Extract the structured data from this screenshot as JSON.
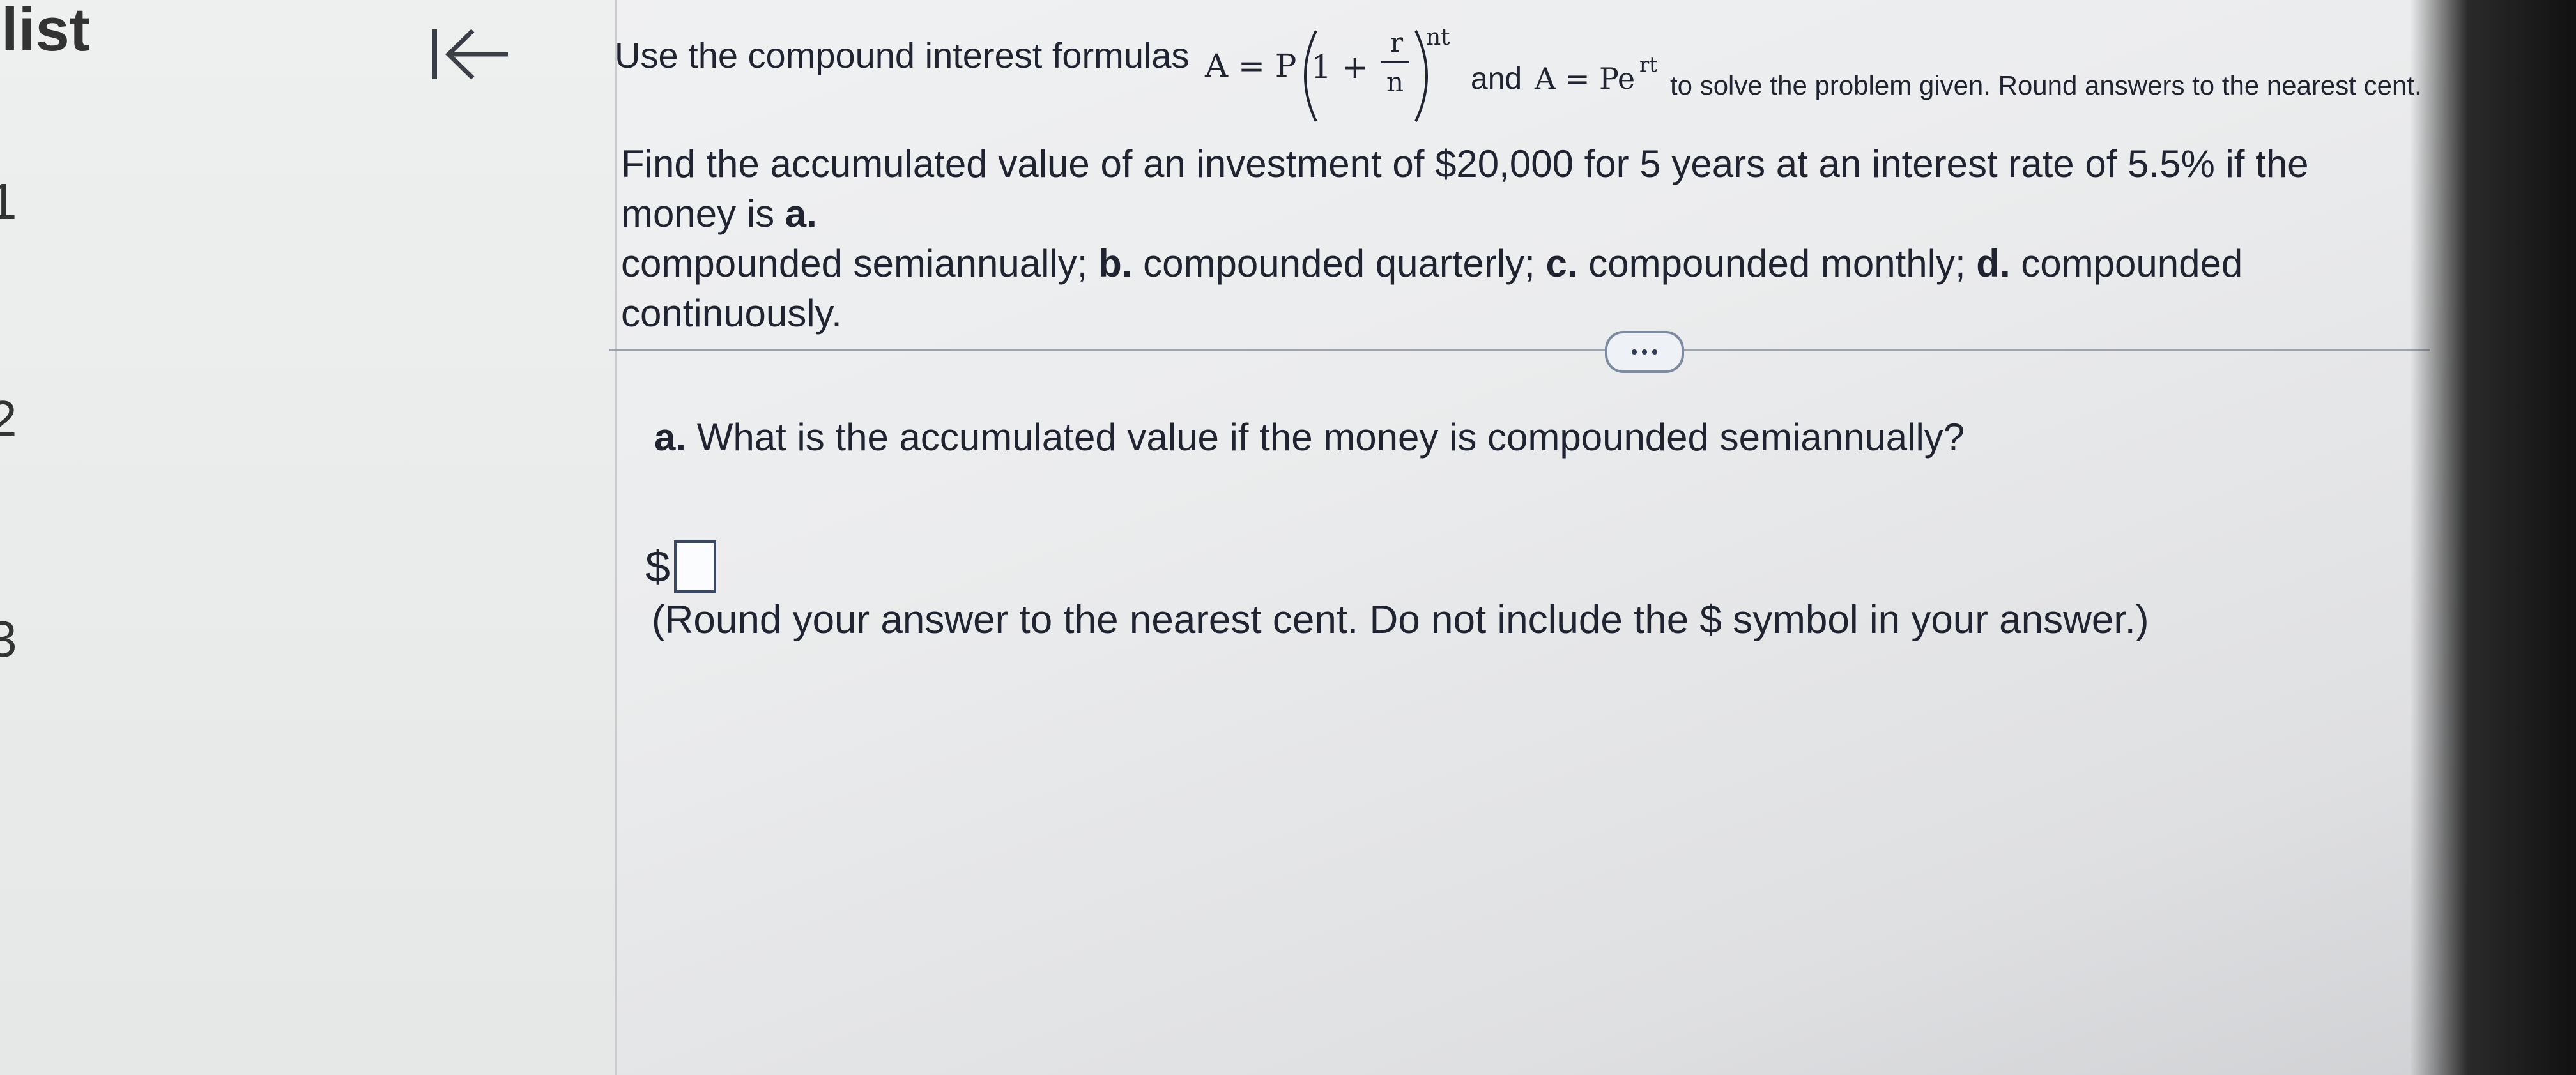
{
  "sidebar": {
    "title": "list",
    "items": [
      "1",
      "2",
      "3"
    ]
  },
  "icons": {
    "back": "arrow-left-to-line-icon",
    "more": "ellipsis-icon"
  },
  "instruction": {
    "prefix": "Use the compound interest formulas",
    "formula1_lhs": "A = P",
    "formula1_inner": "1 +",
    "formula1_num": "r",
    "formula1_den": "n",
    "formula1_exp": "nt",
    "conjunction": "and",
    "formula2_lhs": "A = Pe",
    "formula2_exp": "rt",
    "suffix": "to solve the problem given. Round answers to the nearest cent."
  },
  "problem": {
    "line1": "Find the accumulated value of an investment of $20,000 for 5 years at an interest rate of 5.5% if the money is",
    "a_label": "a.",
    "a_text": "compounded semiannually;",
    "b_label": "b.",
    "b_text": "compounded quarterly;",
    "c_label": "c.",
    "c_text": "compounded monthly;",
    "d_label": "d.",
    "d_text": "compounded continuously."
  },
  "question": {
    "label": "a.",
    "text": "What is the accumulated value if the money is compounded semiannually?"
  },
  "answer": {
    "currency": "$",
    "value": "",
    "hint": "(Round your answer to the nearest cent. Do not include the $ symbol in your answer.)"
  },
  "colors": {
    "text": "#1f2430",
    "input_border": "#3a4a66",
    "divider": "#9da3ad"
  }
}
